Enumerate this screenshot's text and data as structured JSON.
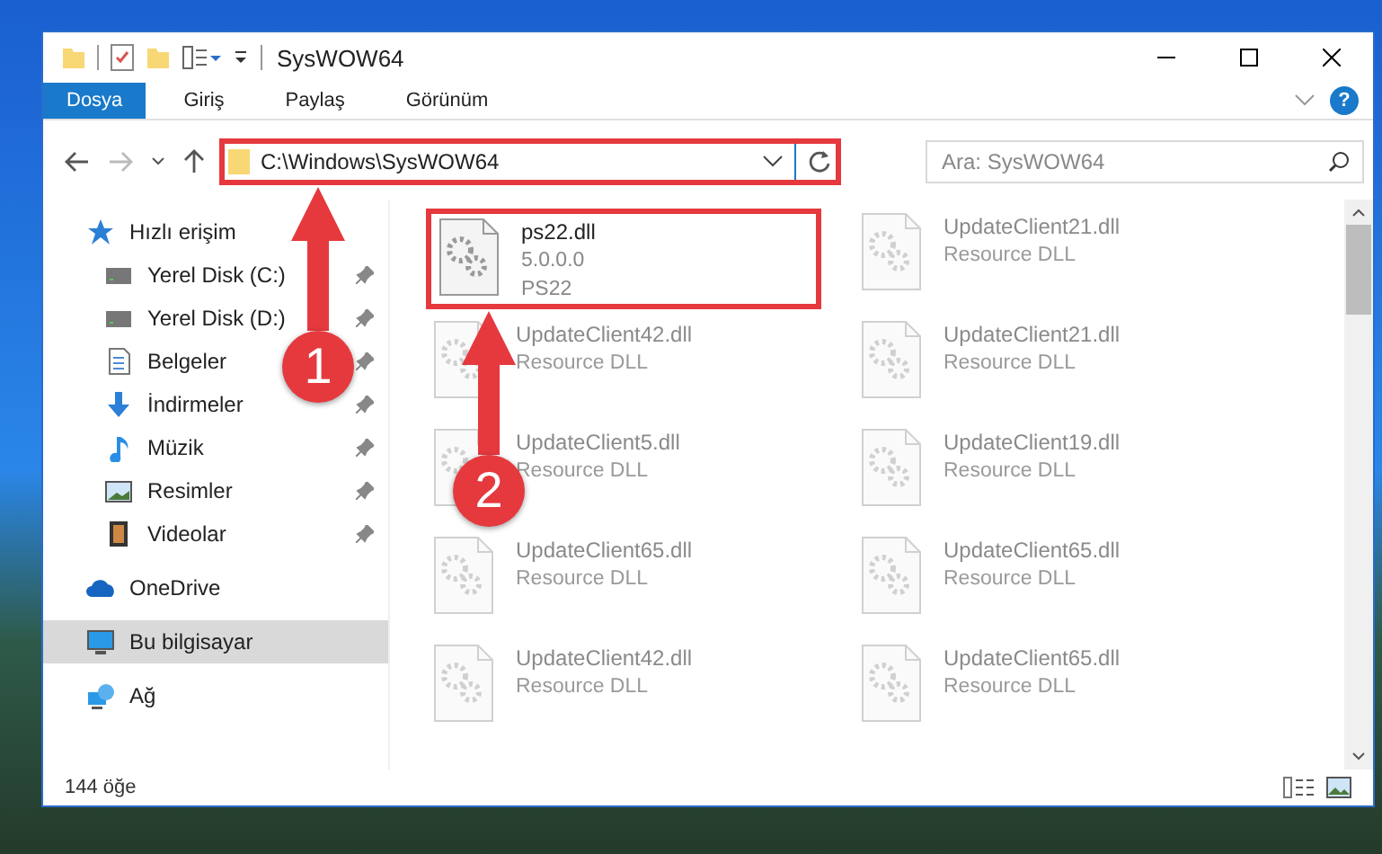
{
  "window": {
    "title": "SysWOW64"
  },
  "ribbon_tabs": [
    {
      "label": "Dosya",
      "selected": true
    },
    {
      "label": "Giriş",
      "selected": false
    },
    {
      "label": "Paylaş",
      "selected": false
    },
    {
      "label": "Görünüm",
      "selected": false
    }
  ],
  "help_button": {
    "label": "?"
  },
  "address_bar": {
    "path": "C:\\Windows\\SysWOW64",
    "highlighted": true
  },
  "search": {
    "placeholder": "Ara: SysWOW64"
  },
  "sidebar": {
    "items": [
      {
        "label": "Hızlı erişim",
        "kind": "star",
        "pinned": false,
        "selected": false,
        "children": [
          {
            "label": "Yerel Disk (C:)",
            "kind": "disk",
            "pinned": true,
            "selected": false
          },
          {
            "label": "Yerel Disk (D:)",
            "kind": "disk",
            "pinned": true,
            "selected": false
          },
          {
            "label": "Belgeler",
            "kind": "docs",
            "pinned": true,
            "selected": false
          },
          {
            "label": "İndirmeler",
            "kind": "download",
            "pinned": true,
            "selected": false
          },
          {
            "label": "Müzik",
            "kind": "music",
            "pinned": true,
            "selected": false
          },
          {
            "label": "Resimler",
            "kind": "pictures",
            "pinned": true,
            "selected": false
          },
          {
            "label": "Videolar",
            "kind": "videos",
            "pinned": true,
            "selected": false
          }
        ]
      },
      {
        "label": "OneDrive",
        "kind": "cloud",
        "pinned": false,
        "selected": false
      },
      {
        "label": "Bu bilgisayar",
        "kind": "pc",
        "pinned": false,
        "selected": true
      },
      {
        "label": "Ağ",
        "kind": "network",
        "pinned": false,
        "selected": false
      }
    ]
  },
  "files": [
    {
      "name": "ps22.dll",
      "details": [
        "5.0.0.0",
        "PS22"
      ],
      "highlighted": true
    },
    {
      "name": "UpdateClient21.dll",
      "details": [
        "Resource DLL"
      ],
      "highlighted": false
    },
    {
      "name": "UpdateClient42.dll",
      "details": [
        "Resource DLL"
      ],
      "highlighted": false
    },
    {
      "name": "UpdateClient21.dll",
      "details": [
        "Resource DLL"
      ],
      "highlighted": false
    },
    {
      "name": "UpdateClient5.dll",
      "details": [
        "Resource DLL"
      ],
      "highlighted": false
    },
    {
      "name": "UpdateClient19.dll",
      "details": [
        "Resource DLL"
      ],
      "highlighted": false
    },
    {
      "name": "UpdateClient65.dll",
      "details": [
        "Resource DLL"
      ],
      "highlighted": false
    },
    {
      "name": "UpdateClient65.dll",
      "details": [
        "Resource DLL"
      ],
      "highlighted": false
    },
    {
      "name": "UpdateClient42.dll",
      "details": [
        "Resource DLL"
      ],
      "highlighted": false
    },
    {
      "name": "UpdateClient65.dll",
      "details": [
        "Resource DLL"
      ],
      "highlighted": false
    }
  ],
  "annotations": [
    {
      "number": "1"
    },
    {
      "number": "2"
    }
  ],
  "status_bar": {
    "count": "144 öğe"
  }
}
